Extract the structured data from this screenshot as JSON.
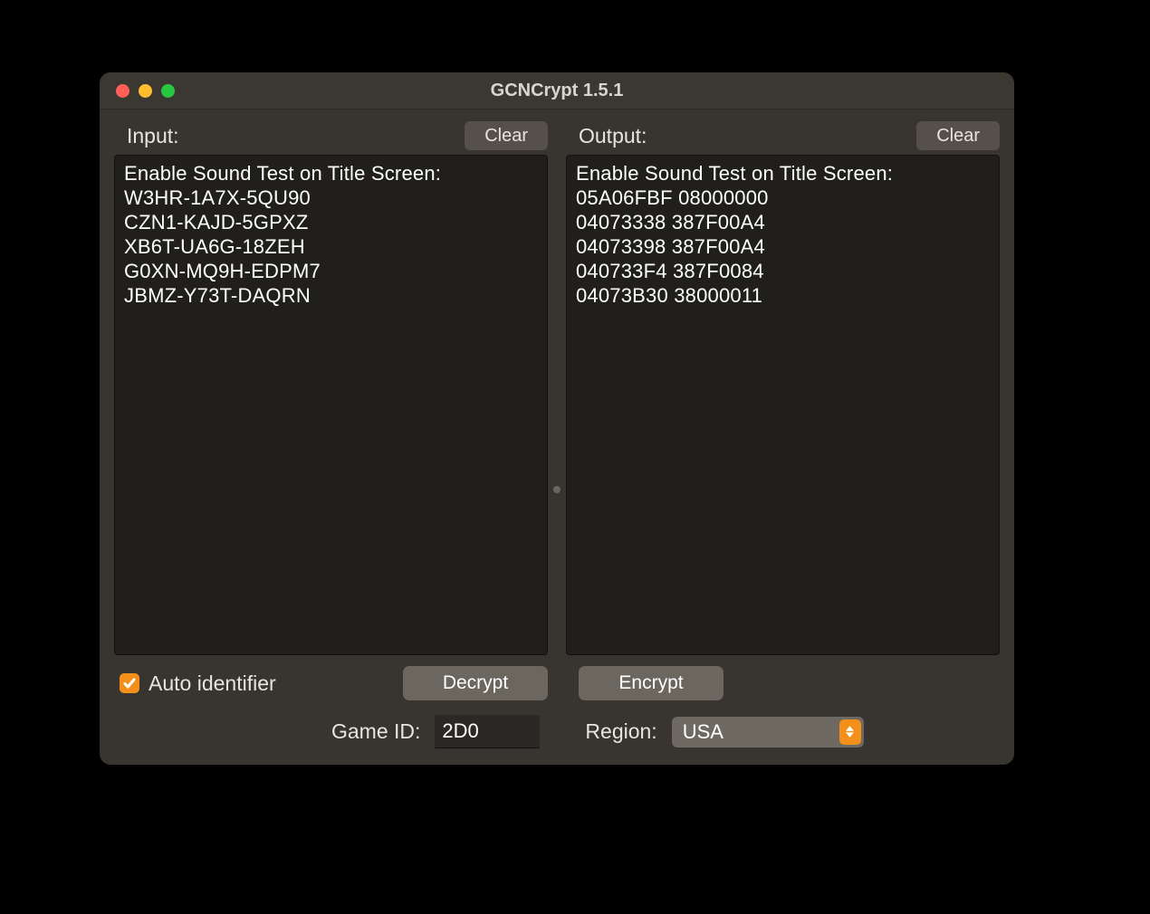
{
  "window": {
    "title": "GCNCrypt 1.5.1"
  },
  "panes": {
    "input": {
      "label": "Input:",
      "clear_label": "Clear",
      "text": "Enable Sound Test on Title Screen:\nW3HR-1A7X-5QU90\nCZN1-KAJD-5GPXZ\nXB6T-UA6G-18ZEH\nG0XN-MQ9H-EDPM7\nJBMZ-Y73T-DAQRN"
    },
    "output": {
      "label": "Output:",
      "clear_label": "Clear",
      "text": "Enable Sound Test on Title Screen:\n05A06FBF 08000000\n04073338 387F00A4\n04073398 387F00A4\n040733F4 387F0084\n04073B30 38000011"
    }
  },
  "actions": {
    "auto_identifier_label": "Auto identifier",
    "auto_identifier_checked": true,
    "decrypt_label": "Decrypt",
    "encrypt_label": "Encrypt"
  },
  "footer": {
    "game_id_label": "Game ID:",
    "game_id_value": "2D0",
    "region_label": "Region:",
    "region_value": "USA"
  }
}
